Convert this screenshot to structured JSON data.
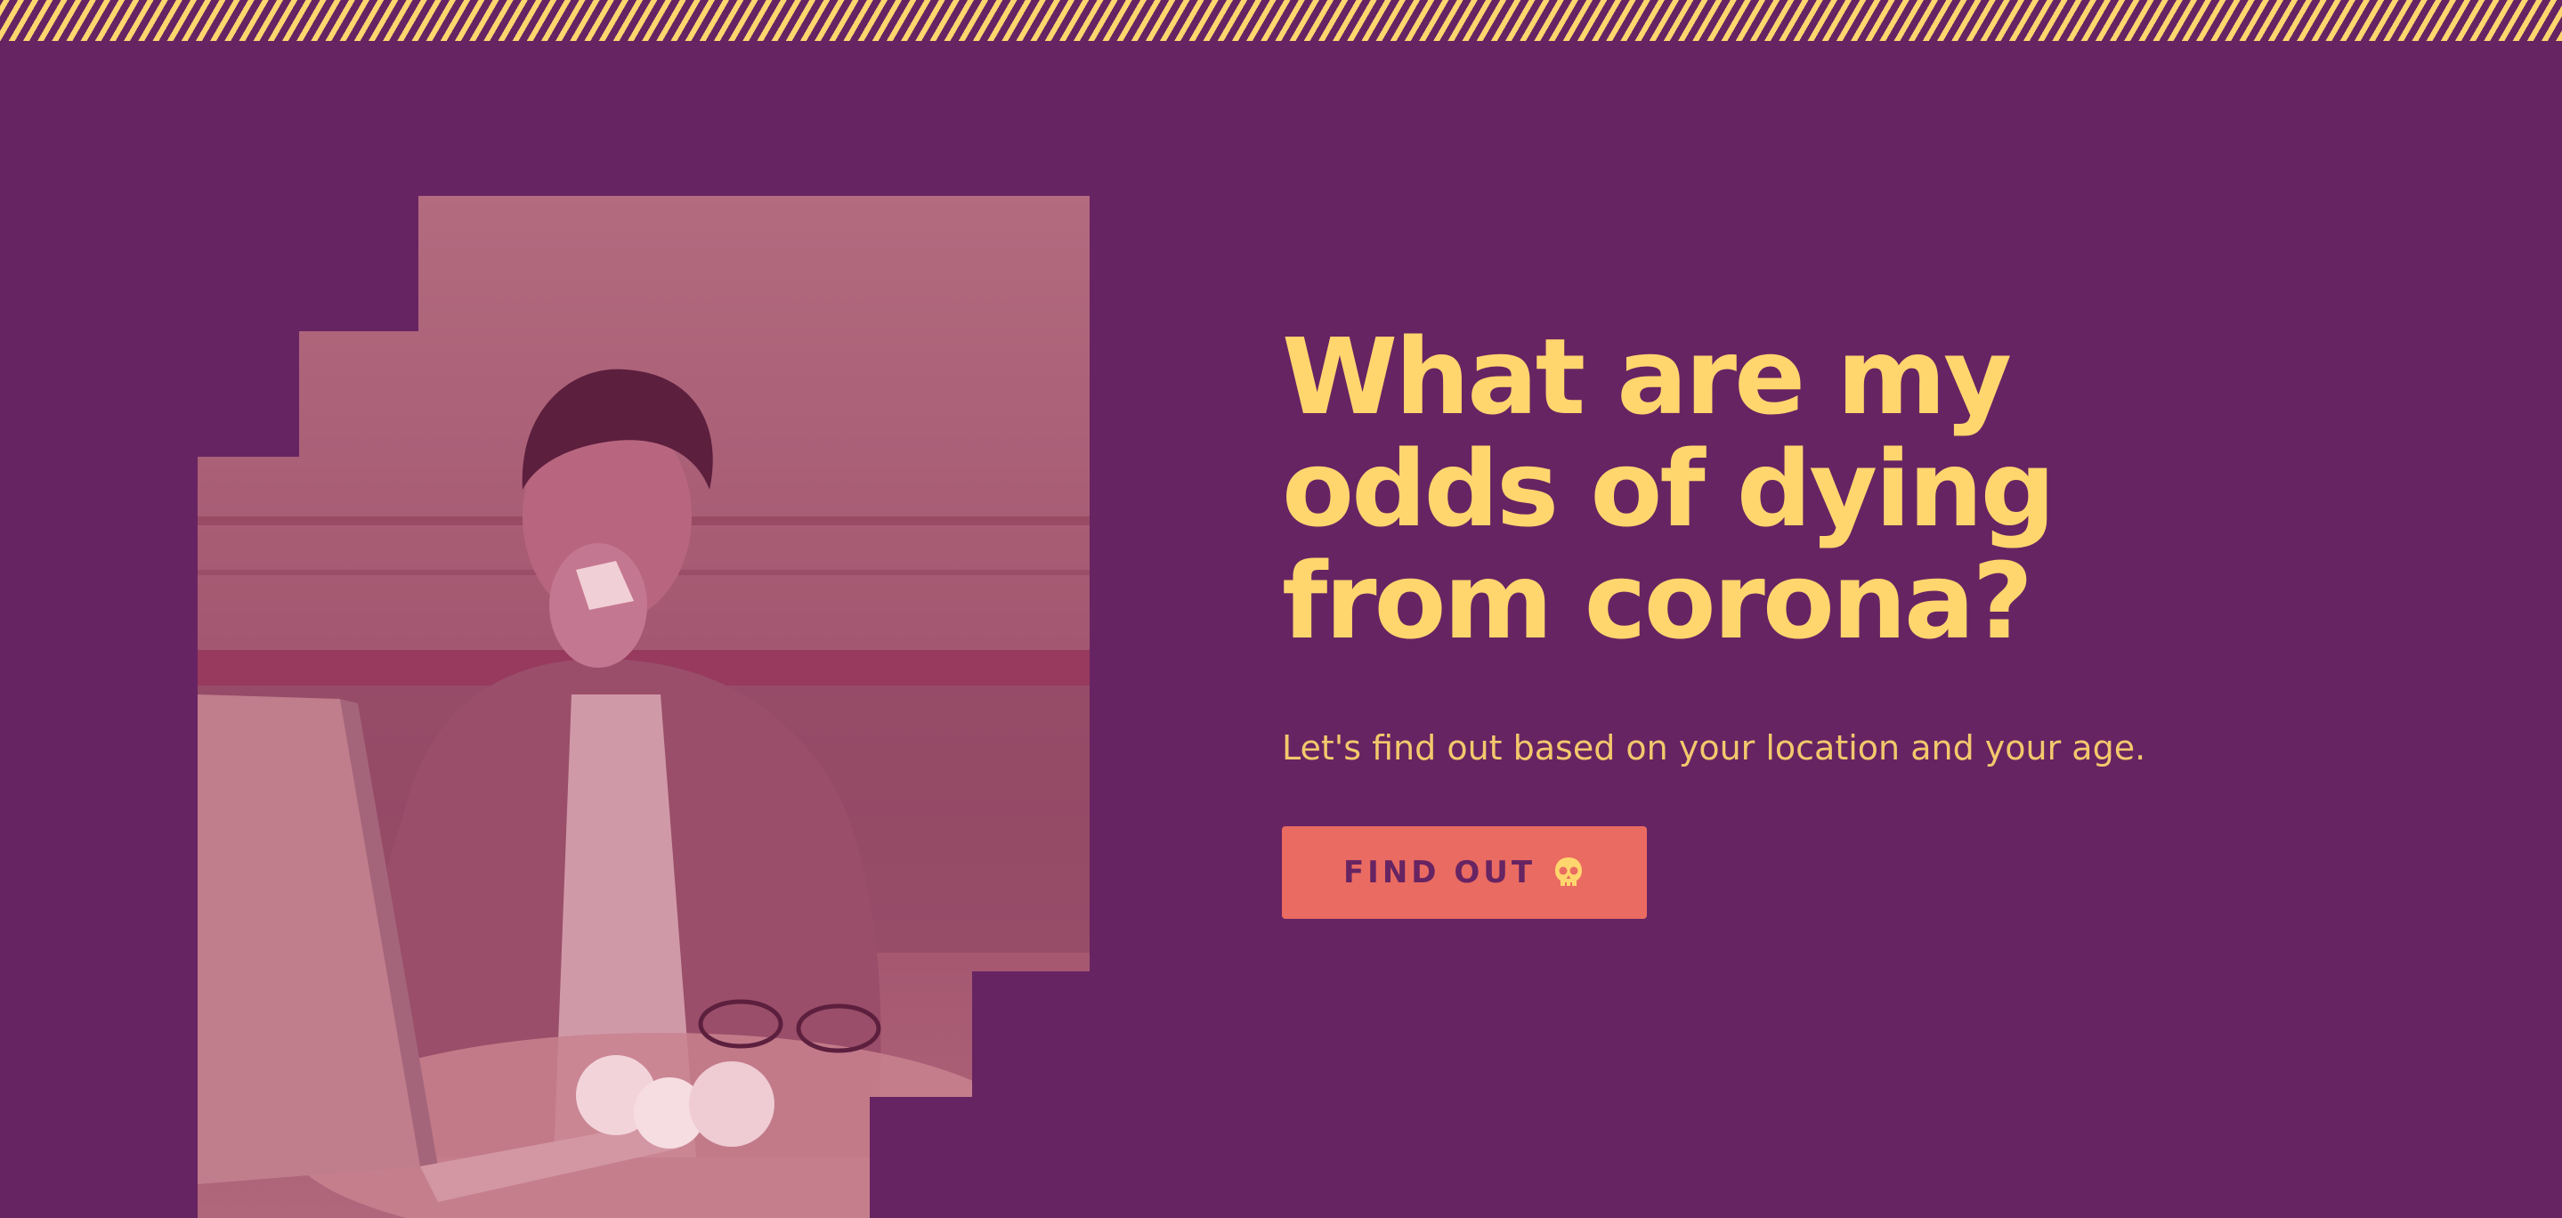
{
  "hero": {
    "headline": "What are my odds of dying from corona?",
    "subtitle": "Let's find out based on your location and your age.",
    "cta_label": "FIND OUT",
    "cta_icon": "skull-icon"
  },
  "photo": {
    "subject": "man-sneezing-into-tissue-at-laptop"
  },
  "colors": {
    "background": "#672462",
    "accent_yellow": "#ffd66e",
    "button": "#ea6b61",
    "photo_tint": "#a85d75"
  }
}
